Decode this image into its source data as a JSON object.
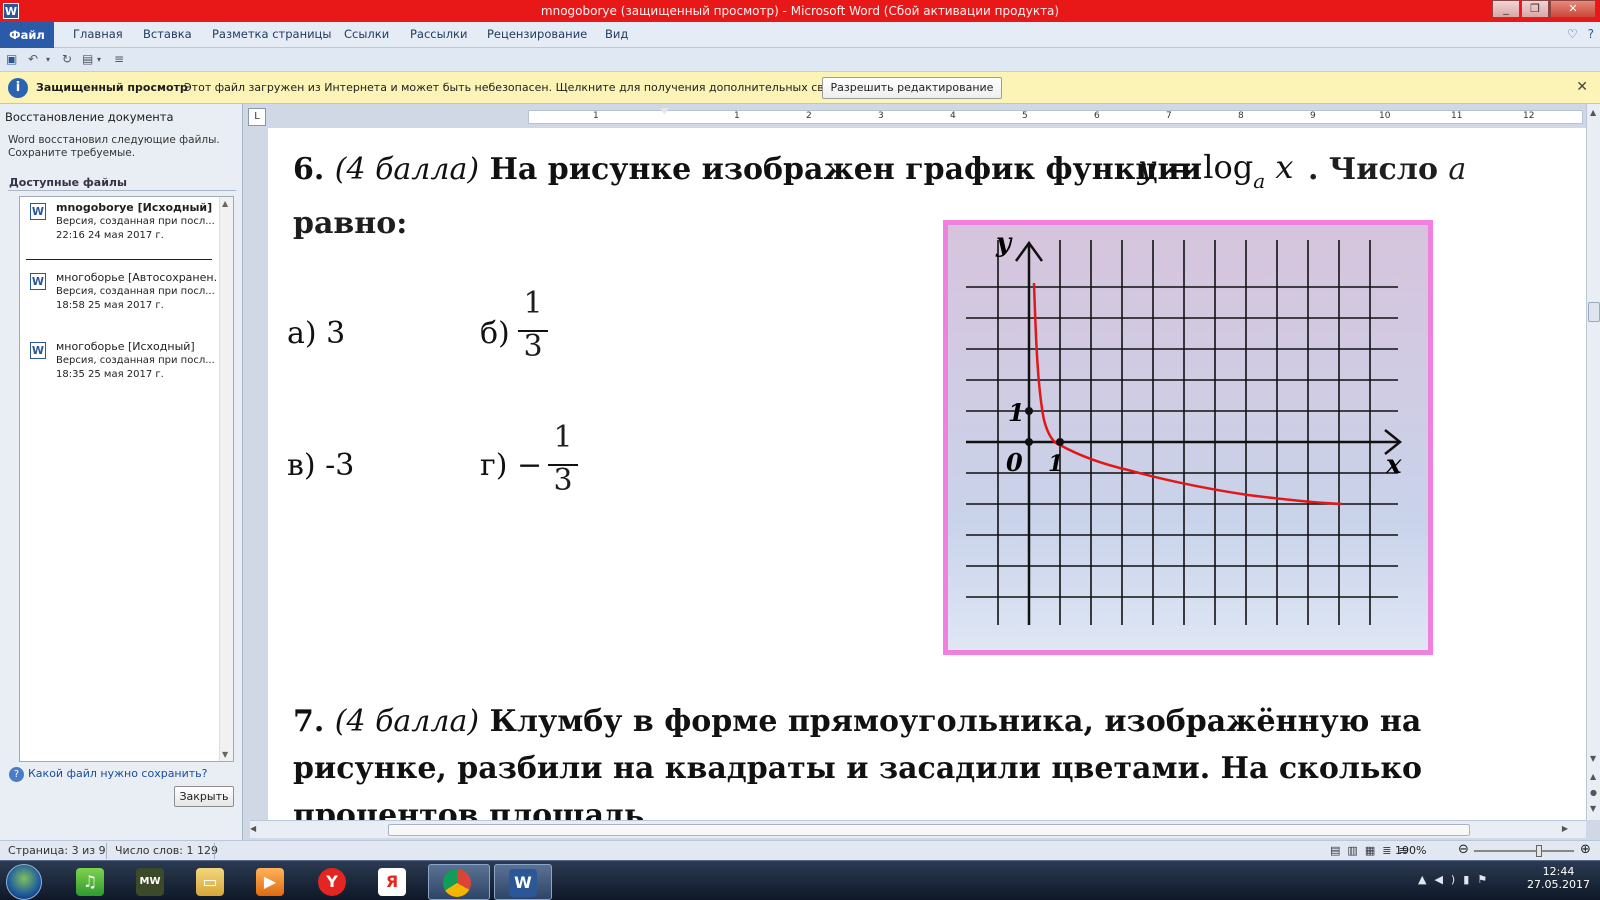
{
  "window": {
    "title": "mnogoborye (защищенный просмотр)  -  Microsoft Word (Сбой активации продукта)",
    "app_icon": "W"
  },
  "ribbon": {
    "file_tab": "Файл",
    "tabs": [
      "Главная",
      "Вставка",
      "Разметка страницы",
      "Ссылки",
      "Рассылки",
      "Рецензирование",
      "Вид"
    ]
  },
  "protected_view": {
    "title": "Защищенный просмотр",
    "message": "Этот файл загружен из Интернета и может быть небезопасен. Щелкните для получения дополнительных сведений.",
    "button": "Разрешить редактирование",
    "close": "✕"
  },
  "recovery_pane": {
    "title": "Восстановление документа",
    "message": "Word восстановил следующие файлы. Сохраните требуемые.",
    "heading": "Доступные файлы",
    "files": [
      {
        "name": "mnogoborye  [Исходный]",
        "desc": "Версия, созданная при посл...",
        "date": "22:16 24 мая 2017 г."
      },
      {
        "name": "многоборье  [Автосохранен...",
        "desc": "Версия, созданная при посл...",
        "date": "18:58 25 мая 2017 г."
      },
      {
        "name": "многоборье  [Исходный]",
        "desc": "Версия, созданная при посл...",
        "date": "18:35 25 мая 2017 г."
      }
    ],
    "help": "Какой файл нужно сохранить?",
    "close_button": "Закрыть"
  },
  "ruler": {
    "corner": "L",
    "numbers": [
      "1",
      "1",
      "2",
      "3",
      "4",
      "5",
      "6",
      "7",
      "8",
      "9",
      "10",
      "11",
      "12"
    ]
  },
  "document": {
    "q6_number": "6.",
    "q6_points": "(4 балла)",
    "q6_text": "На рисунке изображен график функции",
    "formula_y": "y",
    "formula_eq": " = log",
    "formula_base": "a",
    "formula_x": " x",
    "q6_after": ". Число",
    "q6_a": "a",
    "q6_line2": "равно:",
    "options": {
      "a_label": "а) 3",
      "b_label": "б)",
      "b_num": "1",
      "b_den": "3",
      "c_label": "в) -3",
      "d_label": "г) −",
      "d_num": "1",
      "d_den": "3"
    },
    "graph": {
      "y_label": "y",
      "x_label": "x",
      "origin_label": "0",
      "one_y": "1",
      "one_x": "1",
      "curve_color": "#e01818"
    },
    "q7_number": "7.",
    "q7_points": "(4 балла)",
    "q7_text": "Клумбу в форме прямоугольника, изображённую на рисунке, разбили на квадраты и засадили цветами. На сколько процентов площадь"
  },
  "status": {
    "page": "Страница: 3 из 9",
    "words": "Число слов: 1 129",
    "zoom": "190%"
  },
  "taskbar": {
    "time": "12:44",
    "date": "27.05.2017",
    "apps": [
      "music-app",
      "nfs-mw-app",
      "explorer-app",
      "media-player-app",
      "yandex-app",
      "yandex-browser-app",
      "chrome-app",
      "word-app"
    ]
  }
}
